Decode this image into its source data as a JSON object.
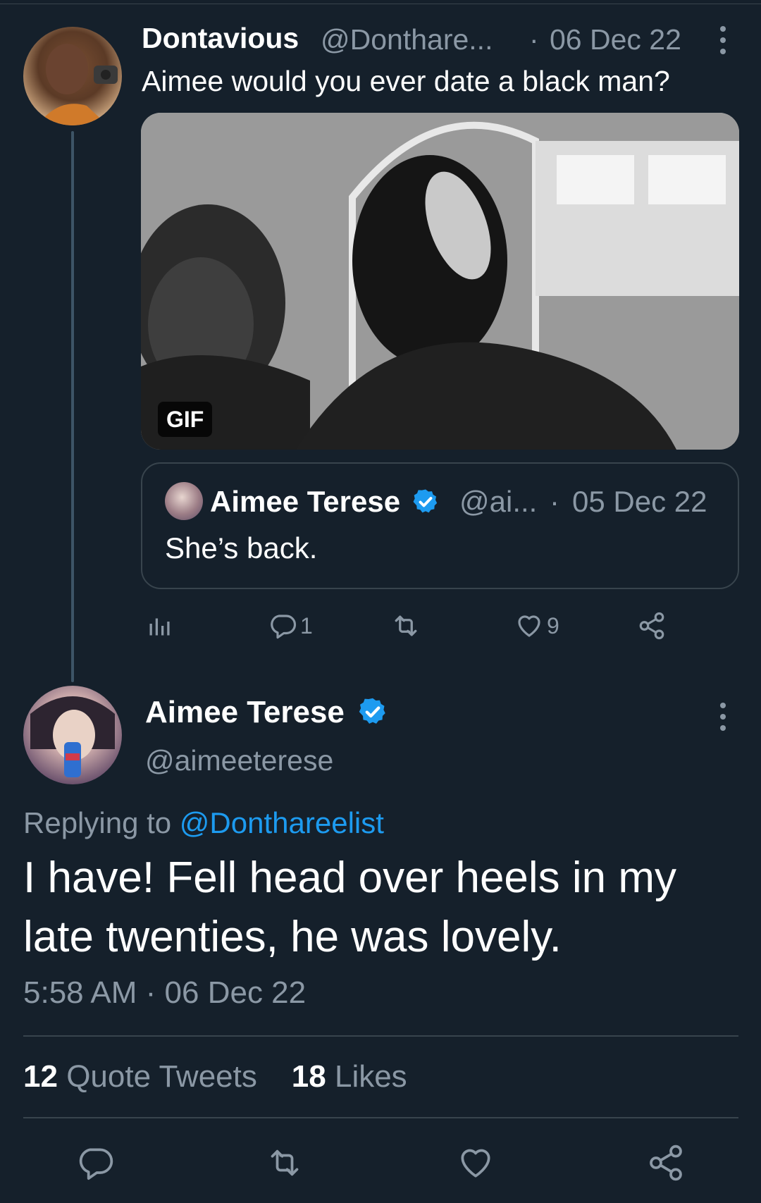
{
  "tweet": {
    "author_name": "Dontavious",
    "author_handle": "@Donthare...",
    "date_separator": "·",
    "date": "06 Dec 22",
    "text": "Aimee would you ever date a black man?",
    "media_badge": "GIF",
    "quoted": {
      "author_name": "Aimee Terese",
      "author_handle": "@ai...",
      "date_separator": "·",
      "date": "05 Dec 22",
      "text": "She’s back."
    },
    "actions": {
      "reply_count": "1",
      "like_count": "9"
    }
  },
  "main_tweet": {
    "author_name": "Aimee Terese",
    "author_handle": "@aimeeterese",
    "replying_prefix": "Replying to ",
    "replying_handle": "@Donthareelist",
    "text": "I have! Fell head over heels in my late twenties, he was lovely.",
    "timestamp": "5:58 AM · 06 Dec 22",
    "stats": {
      "quote_count": "12",
      "quote_label": "Quote Tweets",
      "like_count": "18",
      "like_label": "Likes"
    }
  },
  "colors": {
    "background": "#15202b",
    "muted": "#8b98a5",
    "accent": "#1d9bf0",
    "border": "#38444d"
  },
  "icons": [
    "more-vertical-icon",
    "verified-badge-icon",
    "analytics-icon",
    "reply-icon",
    "retweet-icon",
    "like-icon",
    "share-icon"
  ]
}
